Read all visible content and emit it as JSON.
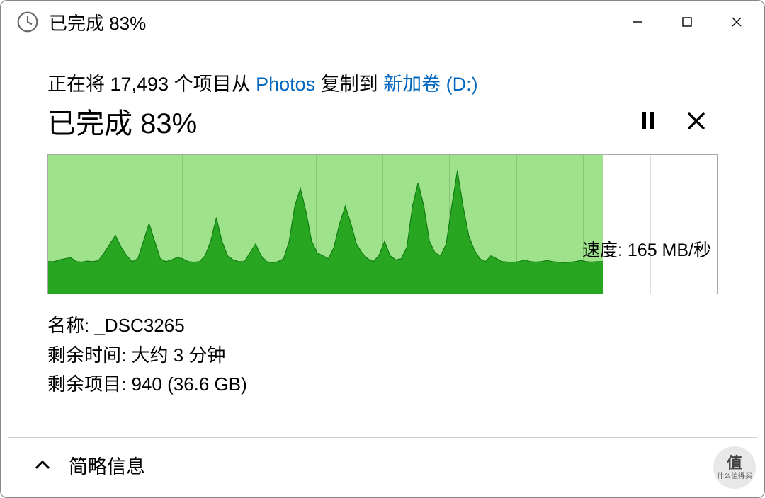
{
  "titlebar": {
    "title": "已完成 83%"
  },
  "copy": {
    "prefix": "正在将 17,493 个项目从 ",
    "source": "Photos",
    "mid": " 复制到 ",
    "dest": "新加卷 (D:)"
  },
  "status": "已完成 83%",
  "speed": {
    "label": "速度:",
    "value": "165 MB/秒"
  },
  "details": {
    "name_label": "名称:",
    "name_value": "_DSC3265",
    "time_label": "剩余时间:",
    "time_value": "大约 3 分钟",
    "items_label": "剩余项目:",
    "items_value": "940 (36.6 GB)"
  },
  "footer": {
    "toggle": "简略信息"
  },
  "chart_data": {
    "type": "area",
    "progress_fraction": 0.83,
    "baseline_fraction_from_top": 0.77,
    "y_unit": "MB/秒",
    "speed_value": 165,
    "grid_columns": 10,
    "values": [
      165,
      165,
      168,
      170,
      172,
      165,
      163,
      166,
      165,
      167,
      180,
      195,
      210,
      190,
      175,
      165,
      170,
      200,
      230,
      200,
      170,
      165,
      168,
      172,
      170,
      165,
      162,
      165,
      175,
      200,
      240,
      200,
      175,
      168,
      165,
      165,
      180,
      195,
      175,
      165,
      160,
      165,
      170,
      200,
      260,
      290,
      250,
      200,
      180,
      175,
      170,
      190,
      230,
      260,
      230,
      195,
      180,
      170,
      165,
      175,
      200,
      175,
      168,
      170,
      190,
      260,
      300,
      260,
      200,
      180,
      175,
      195,
      260,
      320,
      260,
      210,
      185,
      170,
      165,
      175,
      170,
      165,
      163,
      162,
      165,
      168,
      165,
      163,
      165,
      167,
      165,
      162,
      160,
      162,
      165,
      167,
      165,
      163,
      165,
      165
    ]
  },
  "watermark": {
    "glyph": "值",
    "caption": "什么值得买"
  }
}
